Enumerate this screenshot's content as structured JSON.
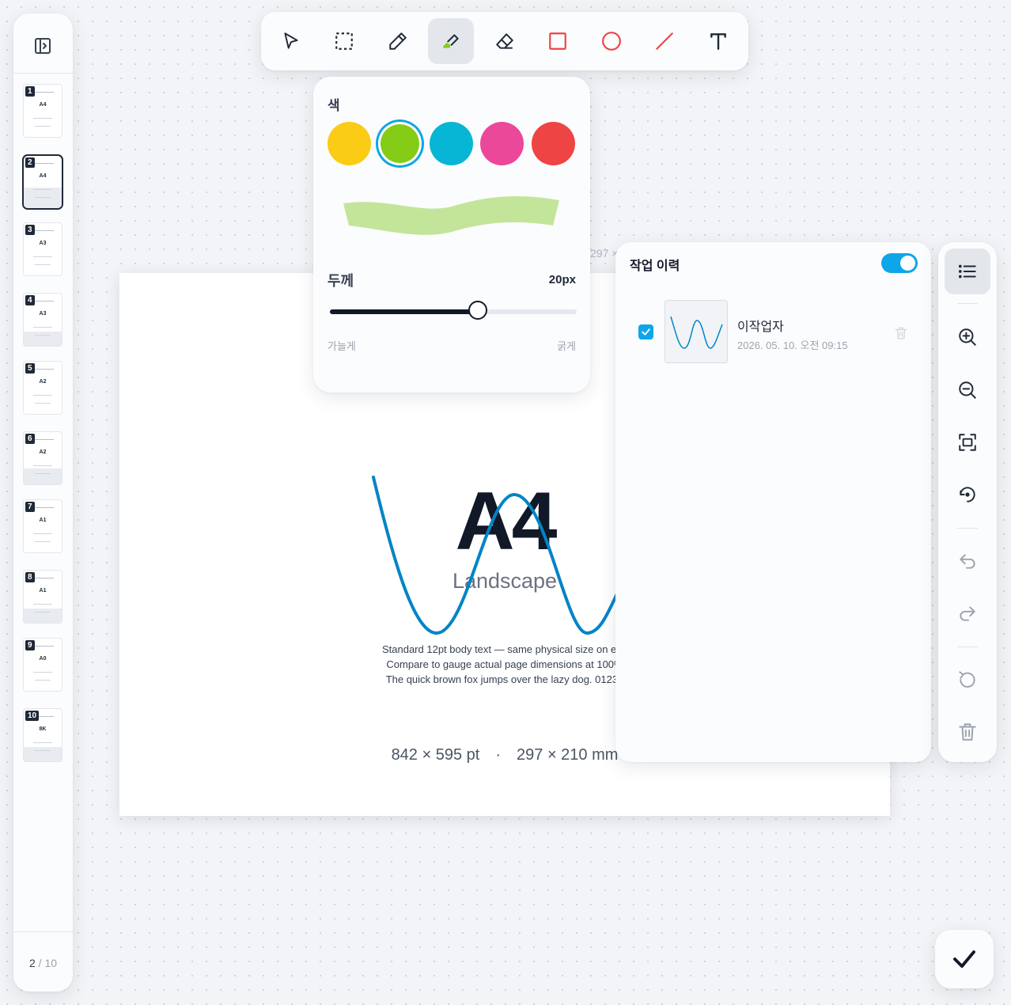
{
  "toolbar": {
    "tools": [
      {
        "name": "select",
        "icon": "cursor-arrow-icon",
        "active": false
      },
      {
        "name": "area-select",
        "icon": "dashed-square-icon",
        "active": false
      },
      {
        "name": "pen",
        "icon": "pencil-icon",
        "active": false
      },
      {
        "name": "highlighter",
        "icon": "highlighter-icon",
        "active": true
      },
      {
        "name": "eraser",
        "icon": "eraser-icon",
        "active": false
      },
      {
        "name": "rectangle",
        "icon": "square-icon",
        "active": false
      },
      {
        "name": "ellipse",
        "icon": "circle-icon",
        "active": false
      },
      {
        "name": "line",
        "icon": "line-icon",
        "active": false
      },
      {
        "name": "text",
        "icon": "text-t-icon",
        "active": false
      }
    ],
    "accent_red": "#ef4444"
  },
  "color_popover": {
    "color_label": "색",
    "swatches": [
      "#facc15",
      "#84cc16",
      "#06b6d4",
      "#ec4899",
      "#ef4444"
    ],
    "selected_index": 1,
    "preview_color": "#c2e59a",
    "thickness_label": "두께",
    "thickness_value": "20px",
    "thickness_fraction": 0.6,
    "thin_label": "가늘게",
    "thick_label": "굵게"
  },
  "sidebar": {
    "toggle_icon": "sidebar-toggle-icon",
    "pages": [
      {
        "num": "1",
        "label": "A4"
      },
      {
        "num": "2",
        "label": "A4"
      },
      {
        "num": "3",
        "label": "A3"
      },
      {
        "num": "4",
        "label": "A3"
      },
      {
        "num": "5",
        "label": "A2"
      },
      {
        "num": "6",
        "label": "A2"
      },
      {
        "num": "7",
        "label": "A1"
      },
      {
        "num": "8",
        "label": "A1"
      },
      {
        "num": "9",
        "label": "A0"
      },
      {
        "num": "10",
        "label": "8K"
      }
    ],
    "active_page": 2,
    "counter_current": "2",
    "counter_sep": "/",
    "counter_total": "10"
  },
  "document": {
    "title": "A4",
    "subtitle": "Landscape",
    "body_lines": [
      "Standard 12pt body text — same physical size on eve",
      "Compare to gauge actual page dimensions at 100%",
      "The quick brown fox jumps over the lazy dog. 01234"
    ],
    "dims_pt": "842 × 595 pt",
    "dims_sep": "·",
    "dims_mm": "297 × 210 mm",
    "ghost_dim": "297 ×",
    "ghost_num": "10",
    "stroke_color": "#0284c7"
  },
  "history": {
    "title": "작업 이력",
    "toggle_on": true,
    "items": [
      {
        "checked": true,
        "author": "이작업자",
        "date": "2026. 05. 10. 오전 09:15"
      }
    ],
    "accent": "#0ea5e9"
  },
  "right_tools": [
    {
      "name": "history-list",
      "icon": "list-icon",
      "active": true
    },
    {
      "name": "zoom-in",
      "icon": "zoom-in-icon"
    },
    {
      "name": "zoom-out",
      "icon": "zoom-out-icon"
    },
    {
      "name": "fit",
      "icon": "fit-screen-icon"
    },
    {
      "name": "rotate",
      "icon": "rotate-icon"
    },
    {
      "name": "undo",
      "icon": "undo-icon"
    },
    {
      "name": "redo",
      "icon": "redo-icon"
    },
    {
      "name": "reset",
      "icon": "reset-icon"
    },
    {
      "name": "delete",
      "icon": "trash-icon"
    }
  ],
  "confirm": {
    "icon": "check-icon"
  }
}
